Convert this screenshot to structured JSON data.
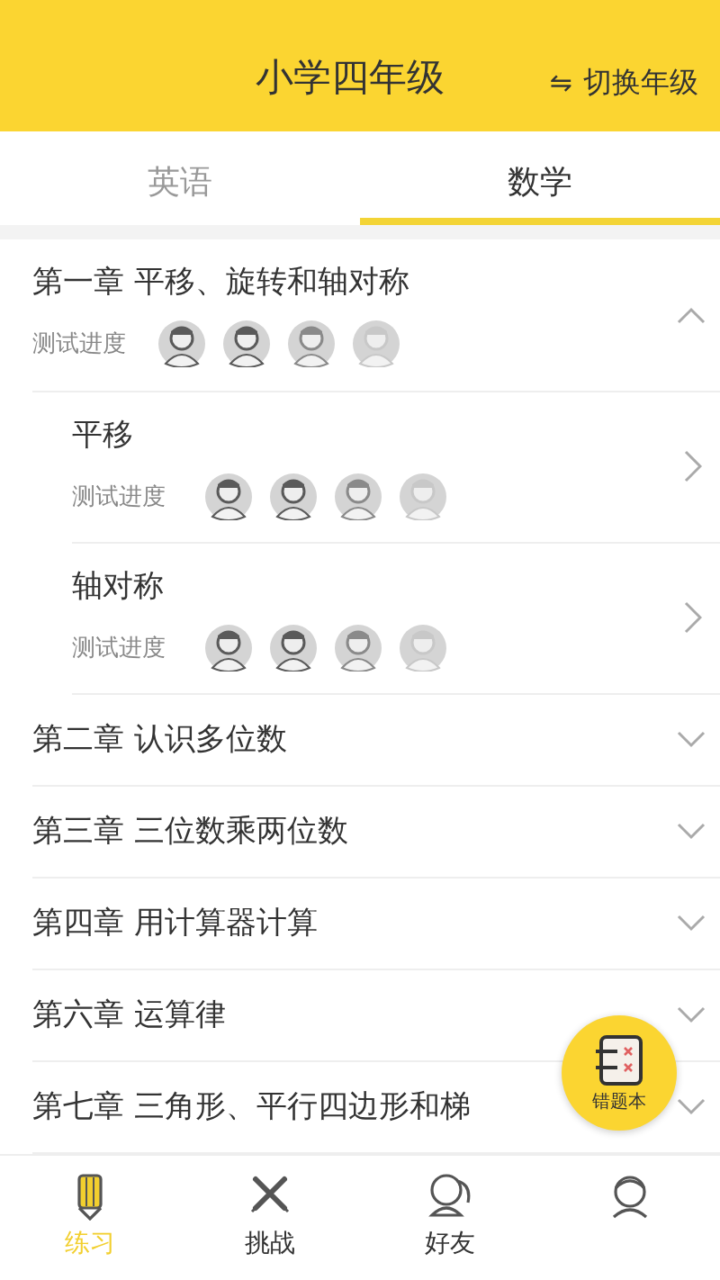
{
  "header": {
    "title": "小学四年级",
    "switch_icon": "⇋",
    "switch_label": "切换年级"
  },
  "subject_tabs": [
    {
      "label": "英语",
      "selected": false
    },
    {
      "label": "数学",
      "selected": true
    }
  ],
  "chapters": [
    {
      "title": "第一章 平移、旋转和轴对称",
      "expanded": true,
      "progress_label": "测试进度",
      "children": [
        {
          "title": "平移",
          "progress_label": "测试进度"
        },
        {
          "title": "轴对称",
          "progress_label": "测试进度"
        }
      ]
    },
    {
      "title": "第二章 认识多位数",
      "expanded": false
    },
    {
      "title": "第三章 三位数乘两位数",
      "expanded": false
    },
    {
      "title": "第四章 用计算器计算",
      "expanded": false
    },
    {
      "title": "第六章 运算律",
      "expanded": false
    },
    {
      "title": "第七章 三角形、平行四边形和梯",
      "expanded": false
    }
  ],
  "floating_button": {
    "label": "错题本"
  },
  "bottom_nav": [
    {
      "label": "练习",
      "selected": true
    },
    {
      "label": "挑战",
      "selected": false
    },
    {
      "label": "好友",
      "selected": false
    },
    {
      "selected": false
    }
  ]
}
